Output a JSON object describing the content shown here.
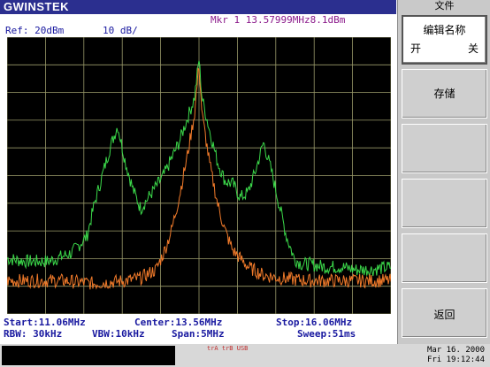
{
  "header": {
    "brand": "GWINSTEK"
  },
  "marker": {
    "text": "Mkr 1 13.57999MHz8.1dBm"
  },
  "ref_level": "Ref: 20dBm",
  "scale_div": "10 dB/",
  "annotations": {
    "start": "Start:11.06MHz",
    "center": "Center:13.56MHz",
    "stop": "Stop:16.06MHz",
    "rbw": "RBW: 30kHz",
    "vbw": "VBW:10kHz",
    "span": "Span:5MHz",
    "sweep": "Sweep:51ms"
  },
  "status": {
    "trig_a": "trA",
    "trig_b": "trB",
    "usb": "USB"
  },
  "datetime": {
    "date": "Mar 16. 2000",
    "time": "Fri 19:12:44"
  },
  "side_menu": {
    "title": "文件",
    "keys": [
      {
        "label": "编辑名称",
        "opt1": "开",
        "opt2": "关",
        "active": true
      },
      {
        "label": "存储"
      },
      {
        "label": ""
      },
      {
        "label": ""
      },
      {
        "label": ""
      },
      {
        "label": "返回"
      }
    ]
  },
  "colors": {
    "grid": "#9a9a6a",
    "trace_green": "#3bd84a",
    "trace_orange": "#f07a2a",
    "label_blue": "#1a1aa0"
  },
  "chart_data": {
    "type": "line",
    "x_unit": "MHz",
    "y_unit": "dBm",
    "xlim": [
      11.06,
      16.06
    ],
    "ylim": [
      -80,
      20
    ],
    "grid": true,
    "series": [
      {
        "id": "green",
        "x": [
          11.06,
          11.3,
          11.6,
          11.9,
          12.1,
          12.2,
          12.3,
          12.4,
          12.5,
          12.6,
          12.7,
          12.8,
          12.9,
          13.0,
          13.1,
          13.2,
          13.3,
          13.4,
          13.5,
          13.56,
          13.6,
          13.7,
          13.8,
          13.9,
          14.0,
          14.1,
          14.2,
          14.3,
          14.4,
          14.5,
          14.6,
          14.7,
          14.8,
          14.9,
          15.0,
          15.2,
          15.4,
          15.6,
          15.8,
          16.06
        ],
        "y": [
          -60,
          -61,
          -61,
          -58,
          -52,
          -40,
          -30,
          -20,
          -12,
          -25,
          -35,
          -42,
          -38,
          -34,
          -30,
          -24,
          -18,
          -10,
          -2,
          12,
          -2,
          -14,
          -25,
          -32,
          -33,
          -38,
          -36,
          -28,
          -18,
          -28,
          -40,
          -52,
          -60,
          -62,
          -62,
          -63,
          -63,
          -64,
          -64,
          -63
        ]
      },
      {
        "id": "orange",
        "x": [
          11.06,
          11.4,
          11.8,
          12.2,
          12.6,
          12.8,
          13.0,
          13.1,
          13.2,
          13.3,
          13.4,
          13.5,
          13.56,
          13.6,
          13.7,
          13.8,
          13.9,
          14.0,
          14.2,
          14.4,
          14.6,
          15.0,
          15.5,
          16.06
        ],
        "y": [
          -68,
          -68,
          -68,
          -69,
          -68,
          -67,
          -64,
          -58,
          -50,
          -38,
          -24,
          -8,
          10,
          -8,
          -26,
          -40,
          -50,
          -57,
          -63,
          -66,
          -67,
          -68,
          -68,
          -68
        ]
      }
    ]
  }
}
